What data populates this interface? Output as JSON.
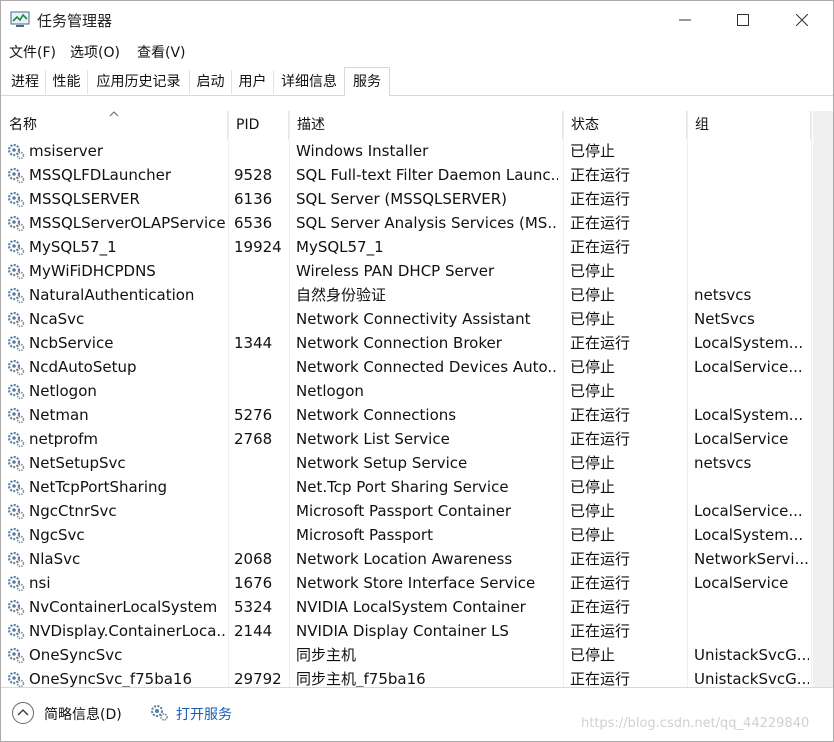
{
  "window": {
    "title": "任务管理器"
  },
  "menu": [
    "文件(F)",
    "选项(O)",
    "查看(V)"
  ],
  "tabs": [
    "进程",
    "性能",
    "应用历史记录",
    "启动",
    "用户",
    "详细信息",
    "服务"
  ],
  "active_tab": "服务",
  "columns": {
    "name": "名称",
    "pid": "PID",
    "desc": "描述",
    "status": "状态",
    "group": "组"
  },
  "rows": [
    {
      "name": "msiserver",
      "pid": "",
      "desc": "Windows Installer",
      "status": "已停止",
      "group": ""
    },
    {
      "name": "MSSQLFDLauncher",
      "pid": "9528",
      "desc": "SQL Full-text Filter Daemon Launc...",
      "status": "正在运行",
      "group": ""
    },
    {
      "name": "MSSQLSERVER",
      "pid": "6136",
      "desc": "SQL Server (MSSQLSERVER)",
      "status": "正在运行",
      "group": ""
    },
    {
      "name": "MSSQLServerOLAPService",
      "pid": "6536",
      "desc": "SQL Server Analysis Services (MS...",
      "status": "正在运行",
      "group": ""
    },
    {
      "name": "MySQL57_1",
      "pid": "19924",
      "desc": "MySQL57_1",
      "status": "正在运行",
      "group": ""
    },
    {
      "name": "MyWiFiDHCPDNS",
      "pid": "",
      "desc": "Wireless PAN DHCP Server",
      "status": "已停止",
      "group": ""
    },
    {
      "name": "NaturalAuthentication",
      "pid": "",
      "desc": "自然身份验证",
      "status": "已停止",
      "group": "netsvcs"
    },
    {
      "name": "NcaSvc",
      "pid": "",
      "desc": "Network Connectivity Assistant",
      "status": "已停止",
      "group": "NetSvcs"
    },
    {
      "name": "NcbService",
      "pid": "1344",
      "desc": "Network Connection Broker",
      "status": "正在运行",
      "group": "LocalSystem..."
    },
    {
      "name": "NcdAutoSetup",
      "pid": "",
      "desc": "Network Connected Devices Auto...",
      "status": "已停止",
      "group": "LocalService..."
    },
    {
      "name": "Netlogon",
      "pid": "",
      "desc": "Netlogon",
      "status": "已停止",
      "group": ""
    },
    {
      "name": "Netman",
      "pid": "5276",
      "desc": "Network Connections",
      "status": "正在运行",
      "group": "LocalSystem..."
    },
    {
      "name": "netprofm",
      "pid": "2768",
      "desc": "Network List Service",
      "status": "正在运行",
      "group": "LocalService"
    },
    {
      "name": "NetSetupSvc",
      "pid": "",
      "desc": "Network Setup Service",
      "status": "已停止",
      "group": "netsvcs"
    },
    {
      "name": "NetTcpPortSharing",
      "pid": "",
      "desc": "Net.Tcp Port Sharing Service",
      "status": "已停止",
      "group": ""
    },
    {
      "name": "NgcCtnrSvc",
      "pid": "",
      "desc": "Microsoft Passport Container",
      "status": "已停止",
      "group": "LocalService..."
    },
    {
      "name": "NgcSvc",
      "pid": "",
      "desc": "Microsoft Passport",
      "status": "已停止",
      "group": "LocalSystem..."
    },
    {
      "name": "NlaSvc",
      "pid": "2068",
      "desc": "Network Location Awareness",
      "status": "正在运行",
      "group": "NetworkServi..."
    },
    {
      "name": "nsi",
      "pid": "1676",
      "desc": "Network Store Interface Service",
      "status": "正在运行",
      "group": "LocalService"
    },
    {
      "name": "NvContainerLocalSystem",
      "pid": "5324",
      "desc": "NVIDIA LocalSystem Container",
      "status": "正在运行",
      "group": ""
    },
    {
      "name": "NVDisplay.ContainerLoca...",
      "pid": "2144",
      "desc": "NVIDIA Display Container LS",
      "status": "正在运行",
      "group": ""
    },
    {
      "name": "OneSyncSvc",
      "pid": "",
      "desc": "同步主机",
      "status": "已停止",
      "group": "UnistackSvcG..."
    },
    {
      "name": "OneSyncSvc_f75ba16",
      "pid": "29792",
      "desc": "同步主机_f75ba16",
      "status": "正在运行",
      "group": "UnistackSvcG..."
    }
  ],
  "footer": {
    "collapse_label": "简略信息(D)",
    "open_services_label": "打开服务",
    "watermark": "https://blog.csdn.net/qq_44229840"
  },
  "icons": {
    "app": "task-manager-icon",
    "service": "gear-icon"
  }
}
